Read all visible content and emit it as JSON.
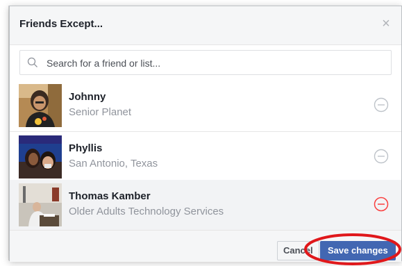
{
  "dialog": {
    "title": "Friends Except...",
    "close_icon": "close-icon"
  },
  "search": {
    "placeholder": "Search for a friend or list..."
  },
  "friends": [
    {
      "name": "Johnny",
      "subtitle": "Senior Planet",
      "highlighted": false,
      "remove_color": "#bec3c9"
    },
    {
      "name": "Phyllis",
      "subtitle": "San Antonio, Texas",
      "highlighted": false,
      "remove_color": "#bec3c9"
    },
    {
      "name": "Thomas Kamber",
      "subtitle": "Older Adults Technology Services",
      "highlighted": true,
      "remove_color": "#fa3e3e"
    }
  ],
  "footer": {
    "cancel_label": "Cancel",
    "save_label": "Save changes"
  },
  "colors": {
    "accent": "#4267b2",
    "annotation": "#e0181b"
  }
}
